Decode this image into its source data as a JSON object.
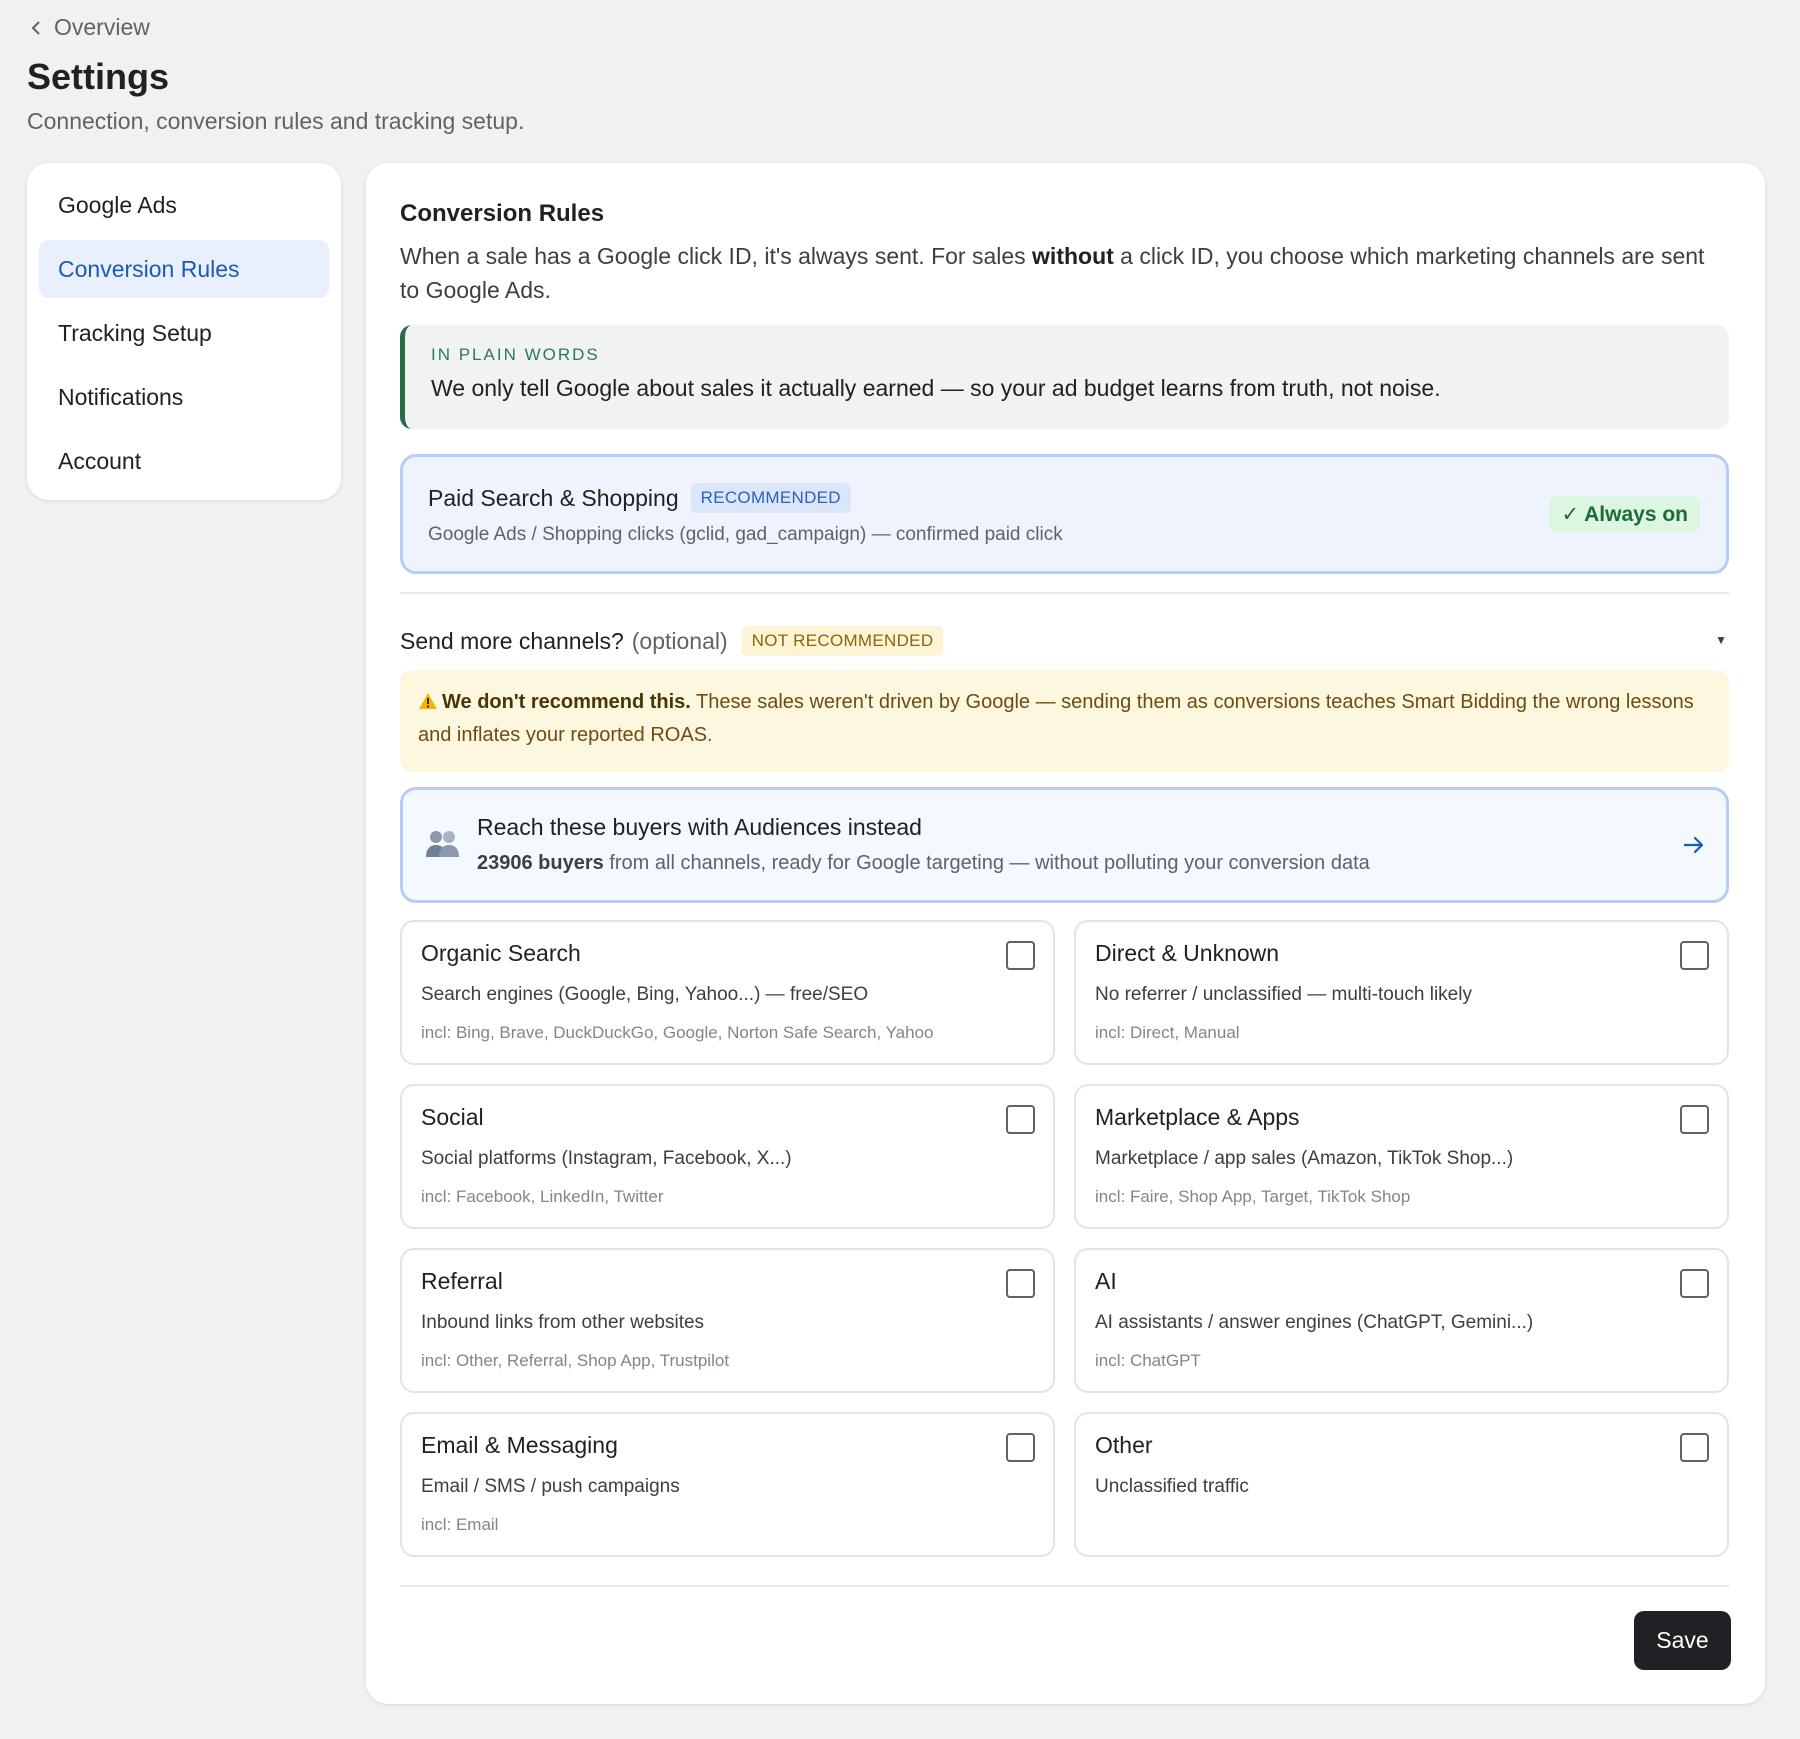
{
  "header": {
    "back_label": "Overview",
    "title": "Settings",
    "subtitle": "Connection, conversion rules and tracking setup."
  },
  "sidebar": {
    "items": [
      {
        "label": "Google Ads",
        "active": false
      },
      {
        "label": "Conversion Rules",
        "active": true
      },
      {
        "label": "Tracking Setup",
        "active": false
      },
      {
        "label": "Notifications",
        "active": false
      },
      {
        "label": "Account",
        "active": false
      }
    ]
  },
  "main": {
    "title": "Conversion Rules",
    "intro_part1": "When a sale has a Google click ID, it's always sent. For sales ",
    "intro_bold": "without",
    "intro_part2": " a click ID, you choose which marketing channels are sent to Google Ads.",
    "plain_words": {
      "kicker": "IN PLAIN WORDS",
      "text": "We only tell Google about sales it actually earned — so your ad budget learns from truth, not noise."
    },
    "paid": {
      "title": "Paid Search & Shopping",
      "badge": "RECOMMENDED",
      "description": "Google Ads / Shopping clicks (gclid, gad_campaign) — confirmed paid click",
      "status": "✓ Always on"
    },
    "more_channels": {
      "label": "Send more channels?",
      "optional": "(optional)",
      "badge": "NOT RECOMMENDED",
      "expanded": true
    },
    "warning": {
      "icon": "warning-icon",
      "bold": "We don't recommend this.",
      "text": " These sales weren't driven by Google — sending them as conversions teaches Smart Bidding the wrong lessons and inflates your reported ROAS."
    },
    "audiences": {
      "icon": "people-icon",
      "title": "Reach these buyers with Audiences instead",
      "count_text": "23906 buyers",
      "description": " from all channels, ready for Google targeting — without polluting your conversion data"
    },
    "channels": [
      {
        "title": "Organic Search",
        "description": "Search engines (Google, Bing, Yahoo...) — free/SEO",
        "incl": "incl: Bing, Brave, DuckDuckGo, Google, Norton Safe Search, Yahoo",
        "checked": false
      },
      {
        "title": "Direct & Unknown",
        "description": "No referrer / unclassified — multi-touch likely",
        "incl": "incl: Direct, Manual",
        "checked": false
      },
      {
        "title": "Social",
        "description": "Social platforms (Instagram, Facebook, X...)",
        "incl": "incl: Facebook, LinkedIn, Twitter",
        "checked": false
      },
      {
        "title": "Marketplace & Apps",
        "description": "Marketplace / app sales (Amazon, TikTok Shop...)",
        "incl": "incl: Faire, Shop App, Target, TikTok Shop",
        "checked": false
      },
      {
        "title": "Referral",
        "description": "Inbound links from other websites",
        "incl": "incl: Other, Referral, Shop App, Trustpilot",
        "checked": false
      },
      {
        "title": "AI",
        "description": "AI assistants / answer engines (ChatGPT, Gemini...)",
        "incl": "incl: ChatGPT",
        "checked": false
      },
      {
        "title": "Email & Messaging",
        "description": "Email / SMS / push campaigns",
        "incl": "incl: Email",
        "checked": false
      },
      {
        "title": "Other",
        "description": "Unclassified traffic",
        "incl": "",
        "checked": false
      }
    ],
    "save_label": "Save"
  },
  "colors": {
    "accent": "#1a5ab8",
    "success": "#1d6b34",
    "warning": "#8a6510",
    "primary_button": "#202124"
  }
}
